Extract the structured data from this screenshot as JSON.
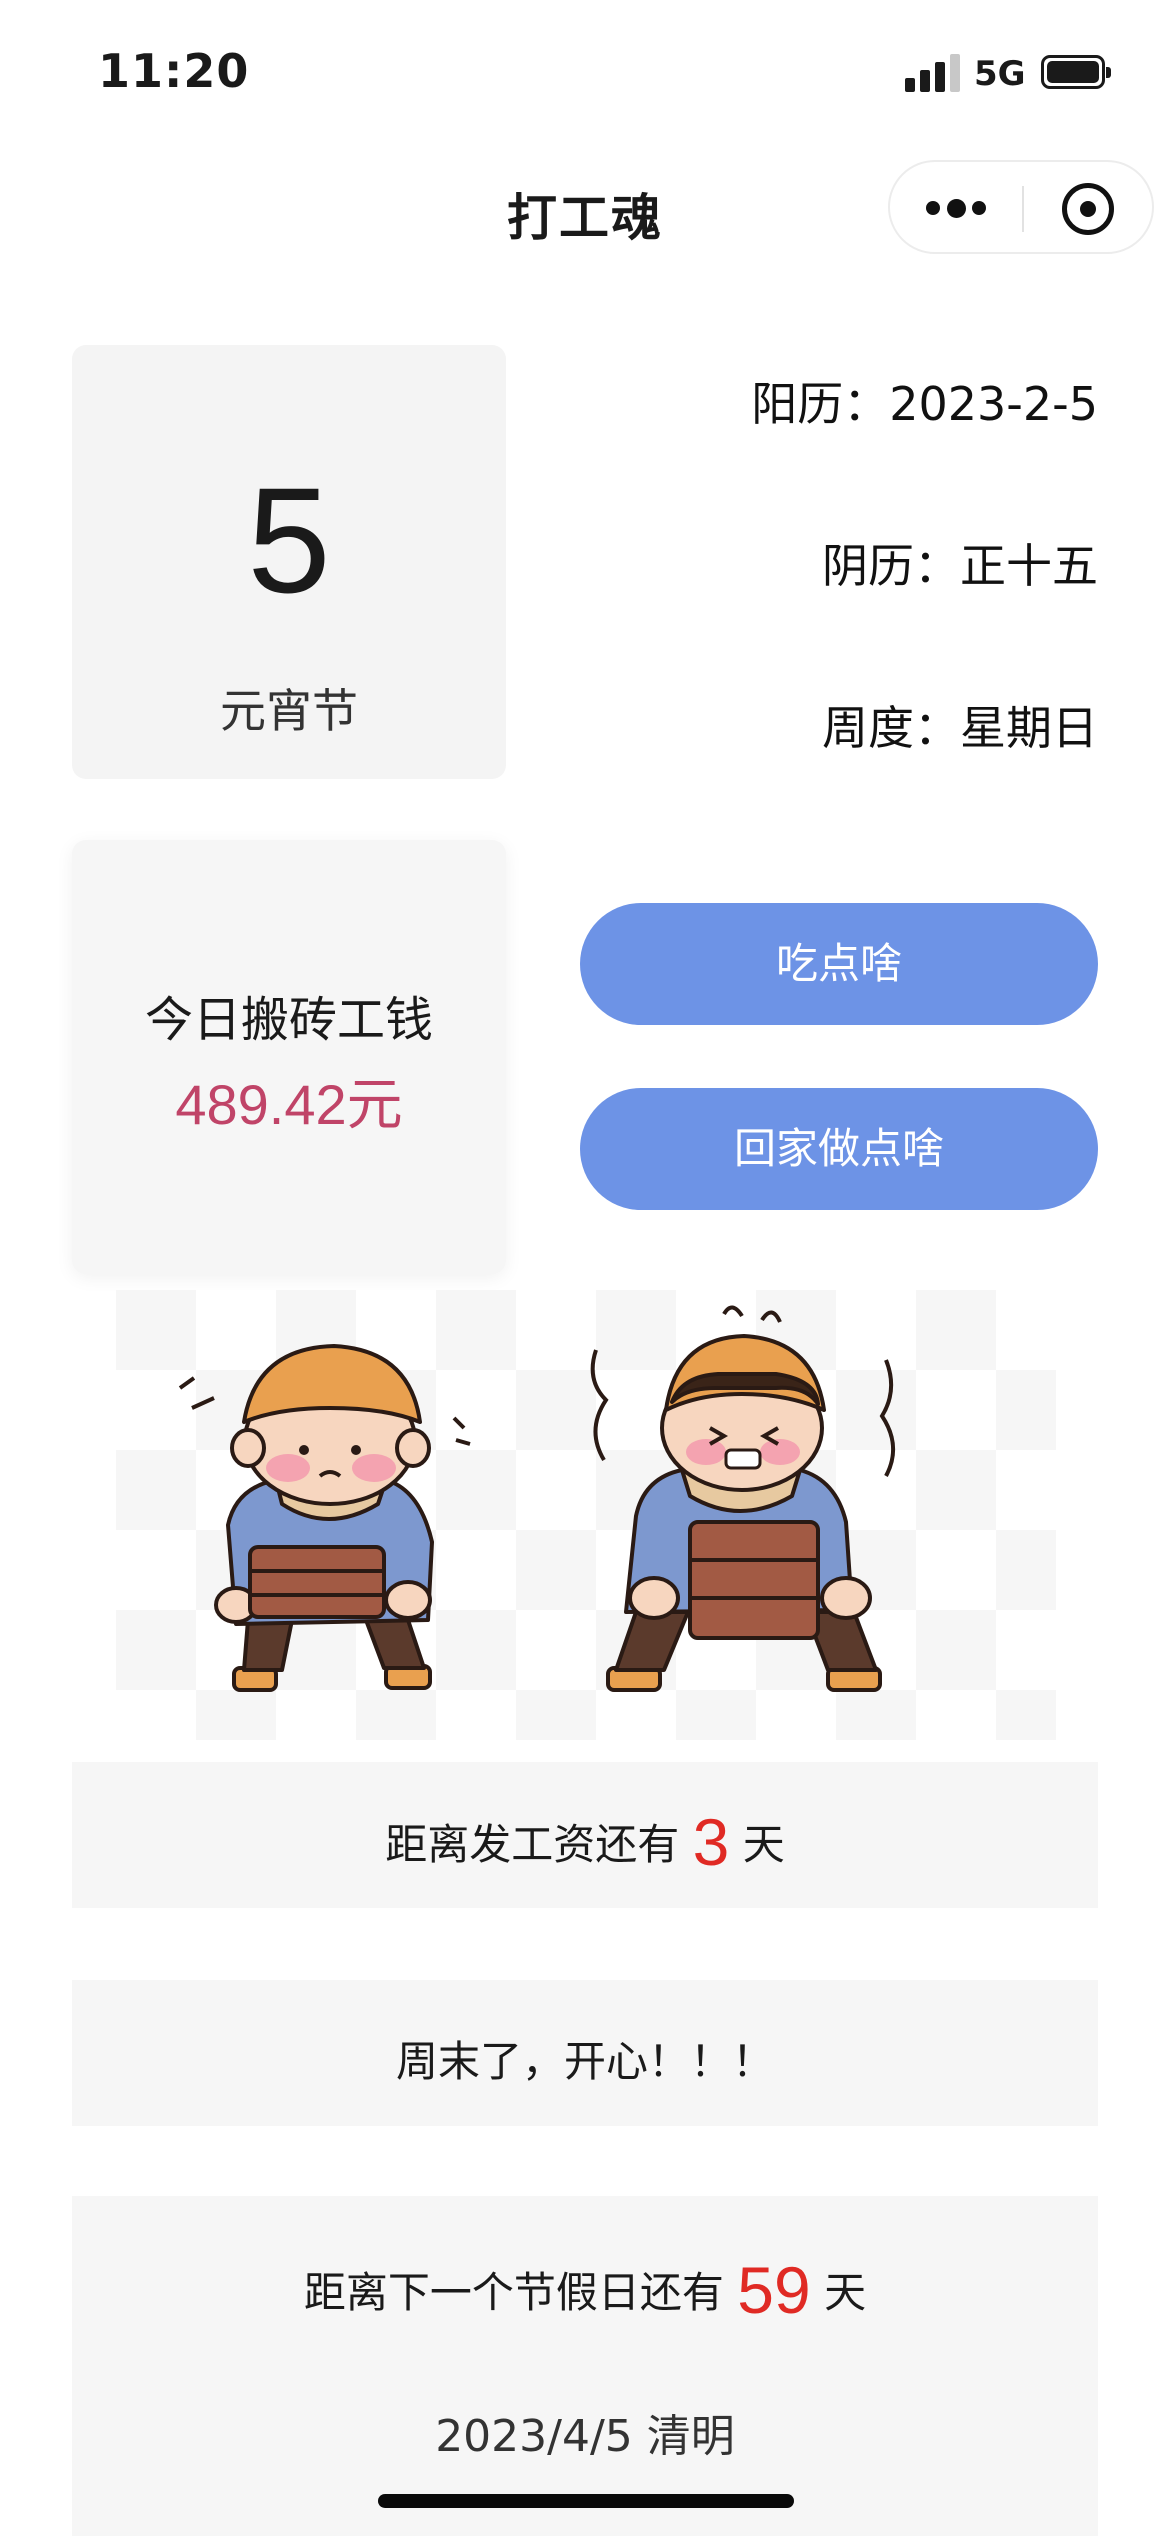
{
  "status_bar": {
    "time": "11:20",
    "network": "5G"
  },
  "nav": {
    "title": "打工魂"
  },
  "date_card": {
    "day": "5",
    "festival": "元宵节"
  },
  "info": {
    "solar": "阳历：2023-2-5",
    "lunar": "阴历：正十五",
    "weekday": "周度：星期日"
  },
  "wage": {
    "title": "今日搬砖工钱",
    "amount": "489.42元"
  },
  "buttons": {
    "eat": "吃点啥",
    "home": "回家做点啥"
  },
  "payday": {
    "prefix": "距离发工资还有",
    "days": "3",
    "suffix": "天"
  },
  "weekend": {
    "text": "周末了，开心！！！"
  },
  "holiday": {
    "prefix": "距离下一个节假日还有",
    "days": "59",
    "suffix": "天",
    "next": "2023/4/5  清明"
  },
  "colors": {
    "accent": "#6d93e6",
    "wage": "#c04468",
    "highlight": "#e02a24"
  }
}
